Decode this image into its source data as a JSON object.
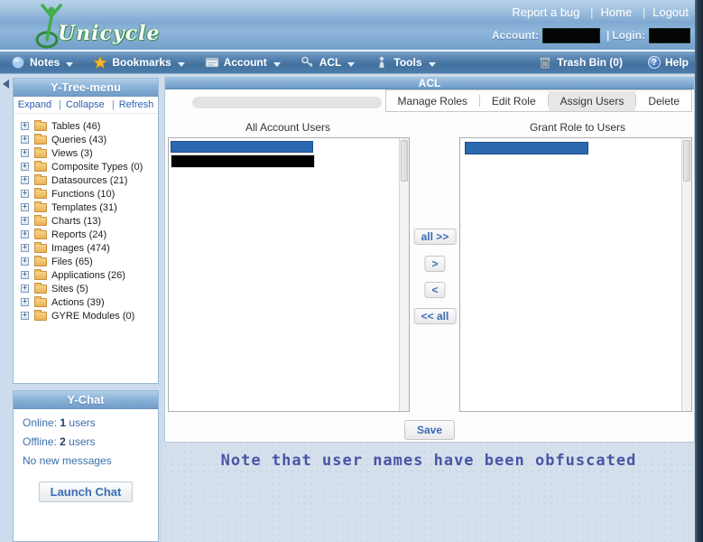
{
  "header": {
    "logo_text": "Unicycle",
    "links": {
      "report_bug": "Report a bug",
      "home": "Home",
      "logout": "Logout"
    },
    "account_label": "Account:",
    "login_label": "Login:",
    "account_value_obfuscated": true,
    "login_value_obfuscated": true
  },
  "navbar": {
    "items": [
      {
        "label": "Notes",
        "icon": "notes-globe"
      },
      {
        "label": "Bookmarks",
        "icon": "star"
      },
      {
        "label": "Account",
        "icon": "card"
      },
      {
        "label": "ACL",
        "icon": "keys"
      },
      {
        "label": "Tools",
        "icon": "tools"
      }
    ],
    "trash_label": "Trash Bin (0)",
    "help_label": "Help",
    "help_glyph": "?"
  },
  "sidebar": {
    "tree": {
      "title": "Y-Tree-menu",
      "actions": {
        "expand": "Expand",
        "collapse": "Collapse",
        "refresh": "Refresh"
      },
      "expander_glyph": "+",
      "items": [
        "Tables (46)",
        "Queries (43)",
        "Views (3)",
        "Composite Types (0)",
        "Datasources (21)",
        "Functions (10)",
        "Templates (31)",
        "Charts (13)",
        "Reports (24)",
        "Images (474)",
        "Files (65)",
        "Applications (26)",
        "Sites (5)",
        "Actions (39)",
        "GYRE Modules (0)"
      ]
    },
    "chat": {
      "title": "Y-Chat",
      "online_label": "Online:",
      "online_count": "1",
      "online_suffix": " users",
      "offline_label": "Offline:",
      "offline_count": "2",
      "offline_suffix": " users",
      "messages": "No new messages",
      "launch_button": "Launch Chat"
    }
  },
  "main": {
    "title": "ACL",
    "tabs": [
      {
        "label": "Manage Roles",
        "active": false
      },
      {
        "label": "Edit Role",
        "active": false
      },
      {
        "label": "Assign Users",
        "active": true
      },
      {
        "label": "Delete",
        "active": false
      }
    ],
    "left_list_label": "All Account Users",
    "right_list_label": "Grant Role to Users",
    "left_list_items": [
      {
        "obfuscated": true,
        "style": "blue-selected"
      },
      {
        "obfuscated": true,
        "style": "black-redacted"
      }
    ],
    "right_list_items": [
      {
        "obfuscated": true,
        "style": "blue-selected"
      }
    ],
    "buttons": {
      "all_right": "all >>",
      "right": ">",
      "left": "<",
      "all_left": "<< all",
      "save": "Save"
    }
  },
  "note": "Note that user names have been obfuscated",
  "colors": {
    "banner_blue": "#7fa9d2",
    "navbar_blue": "#43729f",
    "panel_header_blue": "#6f9dc9",
    "link_blue": "#2a5fae",
    "selected_item_blue": "#2a68b0",
    "button_text_blue": "#3b6cb4",
    "note_blue": "#4a54a6",
    "logo_green": "#2f8a3c",
    "page_bg": "#cddcec"
  }
}
